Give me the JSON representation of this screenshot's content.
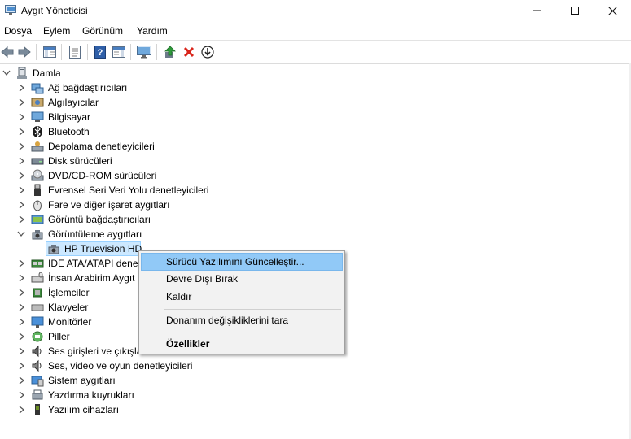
{
  "window": {
    "title": "Aygıt Yöneticisi",
    "minimize": "—",
    "maximize": "☐",
    "close": "✕"
  },
  "menu": [
    "Dosya",
    "Eylem",
    "Görünüm",
    "Yardım"
  ],
  "toolbar": [
    "back",
    "forward",
    "show-hide-console-tree",
    "properties",
    "help",
    "action-pane",
    "scan-hardware-changes",
    "update-driver",
    "uninstall",
    "disable"
  ],
  "tree": {
    "root": "Damla",
    "categories": [
      {
        "label": "Ağ bağdaştırıcıları",
        "icon": "network-adapter-icon",
        "expanded": false
      },
      {
        "label": "Algılayıcılar",
        "icon": "sensor-icon",
        "expanded": false
      },
      {
        "label": "Bilgisayar",
        "icon": "computer-icon",
        "expanded": false
      },
      {
        "label": "Bluetooth",
        "icon": "bluetooth-icon",
        "expanded": false
      },
      {
        "label": "Depolama denetleyicileri",
        "icon": "storage-controller-icon",
        "expanded": false
      },
      {
        "label": "Disk sürücüleri",
        "icon": "disk-drive-icon",
        "expanded": false
      },
      {
        "label": "DVD/CD-ROM sürücüleri",
        "icon": "dvd-icon",
        "expanded": false
      },
      {
        "label": "Evrensel Seri Veri Yolu denetleyicileri",
        "icon": "usb-icon",
        "expanded": false
      },
      {
        "label": "Fare ve diğer işaret aygıtları",
        "icon": "mouse-icon",
        "expanded": false
      },
      {
        "label": "Görüntü bağdaştırıcıları",
        "icon": "display-adapter-icon",
        "expanded": false
      },
      {
        "label": "Görüntüleme aygıtları",
        "icon": "imaging-device-icon",
        "expanded": true
      },
      {
        "label": "IDE ATA/ATAPI denet",
        "icon": "ide-icon",
        "expanded": false
      },
      {
        "label": "İnsan Arabirim Aygıt",
        "icon": "hid-icon",
        "expanded": false
      },
      {
        "label": "İşlemciler",
        "icon": "processor-icon",
        "expanded": false
      },
      {
        "label": "Klavyeler",
        "icon": "keyboard-icon",
        "expanded": false
      },
      {
        "label": "Monitörler",
        "icon": "monitor-icon",
        "expanded": false
      },
      {
        "label": "Piller",
        "icon": "battery-icon",
        "expanded": false
      },
      {
        "label": "Ses girişleri ve çıkışla",
        "icon": "audio-io-icon",
        "expanded": false
      },
      {
        "label": "Ses, video ve oyun denetleyicileri",
        "icon": "sound-video-icon",
        "expanded": false
      },
      {
        "label": "Sistem aygıtları",
        "icon": "system-device-icon",
        "expanded": false
      },
      {
        "label": "Yazdırma kuyrukları",
        "icon": "print-queue-icon",
        "expanded": false
      },
      {
        "label": "Yazılım cihazları",
        "icon": "software-device-icon",
        "expanded": false
      }
    ],
    "selected_device": "HP Truevision HD"
  },
  "context_menu": {
    "items": [
      {
        "label": "Sürücü Yazılımını Güncelleştir...",
        "highlighted": true
      },
      {
        "label": "Devre Dışı Bırak"
      },
      {
        "label": "Kaldır"
      },
      {
        "label": "Donanım değişikliklerini tara"
      },
      {
        "label": "Özellikler",
        "bold": true
      }
    ]
  },
  "colors": {
    "selection": "#cce8ff",
    "menu_highlight": "#91c9f7",
    "menu_bg": "#f2f2f2"
  }
}
